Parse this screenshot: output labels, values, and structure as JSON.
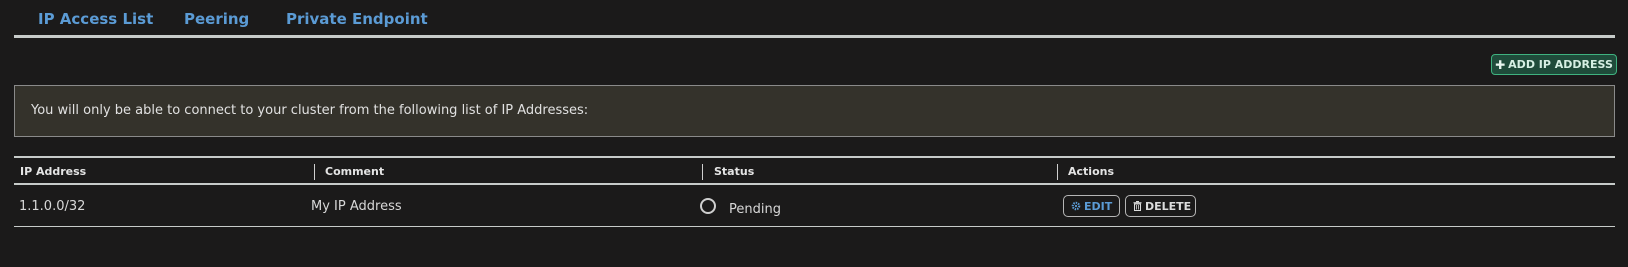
{
  "tabs": [
    {
      "label": "IP Access List"
    },
    {
      "label": "Peering"
    },
    {
      "label": "Private Endpoint"
    }
  ],
  "toolbar": {
    "add_ip_label": "ADD IP ADDRESS",
    "add_icon": "plus-icon"
  },
  "notice": {
    "text": "You will only be able to connect to your cluster from the following list of IP Addresses:"
  },
  "table": {
    "columns": [
      "IP Address",
      "Comment",
      "Status",
      "Actions"
    ],
    "rows": [
      {
        "ip": "1.1.0.0/32",
        "comment": "My IP Address",
        "status": "Pending",
        "status_icon": "empty-circle-icon",
        "edit_label": "EDIT",
        "edit_icon": "gear-icon",
        "delete_label": "DELETE",
        "delete_icon": "trash-icon"
      }
    ]
  },
  "colors": {
    "background": "#1b1a1a",
    "tab_link": "#5b9bd5",
    "add_button_bg": "#1f4b3a",
    "add_button_border": "#3fb27f",
    "notice_bg": "#34322b",
    "divider": "#c7cbc9"
  }
}
